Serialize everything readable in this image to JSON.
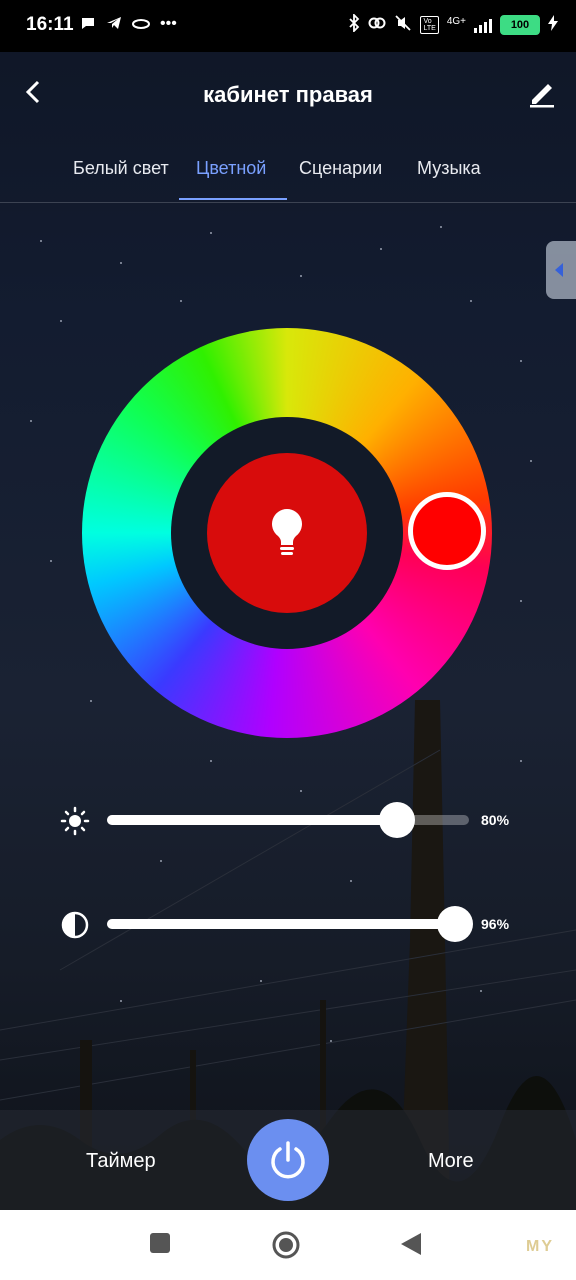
{
  "status_bar": {
    "time": "16:11",
    "battery": "100",
    "network": "4G+",
    "lte_top": "Vo",
    "lte_bottom": "LTE"
  },
  "header": {
    "title": "кабинет правая",
    "back_icon": "chevron-left-icon",
    "edit_icon": "pencil-icon"
  },
  "tabs": [
    {
      "label": "Белый свет",
      "active": false
    },
    {
      "label": "Цветной",
      "active": true
    },
    {
      "label": "Сценарии",
      "active": false
    },
    {
      "label": "Музыка",
      "active": false
    }
  ],
  "color_picker": {
    "selected_color": "#ff0000",
    "center_color": "#d80c0c",
    "center_icon": "light-bulb-icon"
  },
  "sliders": {
    "brightness": {
      "icon": "sun-icon",
      "value_label": "80%",
      "value": 0.8
    },
    "saturation": {
      "icon": "contrast-icon",
      "value_label": "96%",
      "value": 0.96
    }
  },
  "bottom_bar": {
    "timer_label": "Таймер",
    "more_label": "More",
    "power_icon": "power-icon",
    "power_color": "#6b8ff0"
  },
  "nav_bar": {
    "recent_icon": "square-icon",
    "home_icon": "circle-icon",
    "back_icon": "triangle-back-icon",
    "watermark": "MY"
  },
  "colors": {
    "accent": "#7aa0ff"
  }
}
